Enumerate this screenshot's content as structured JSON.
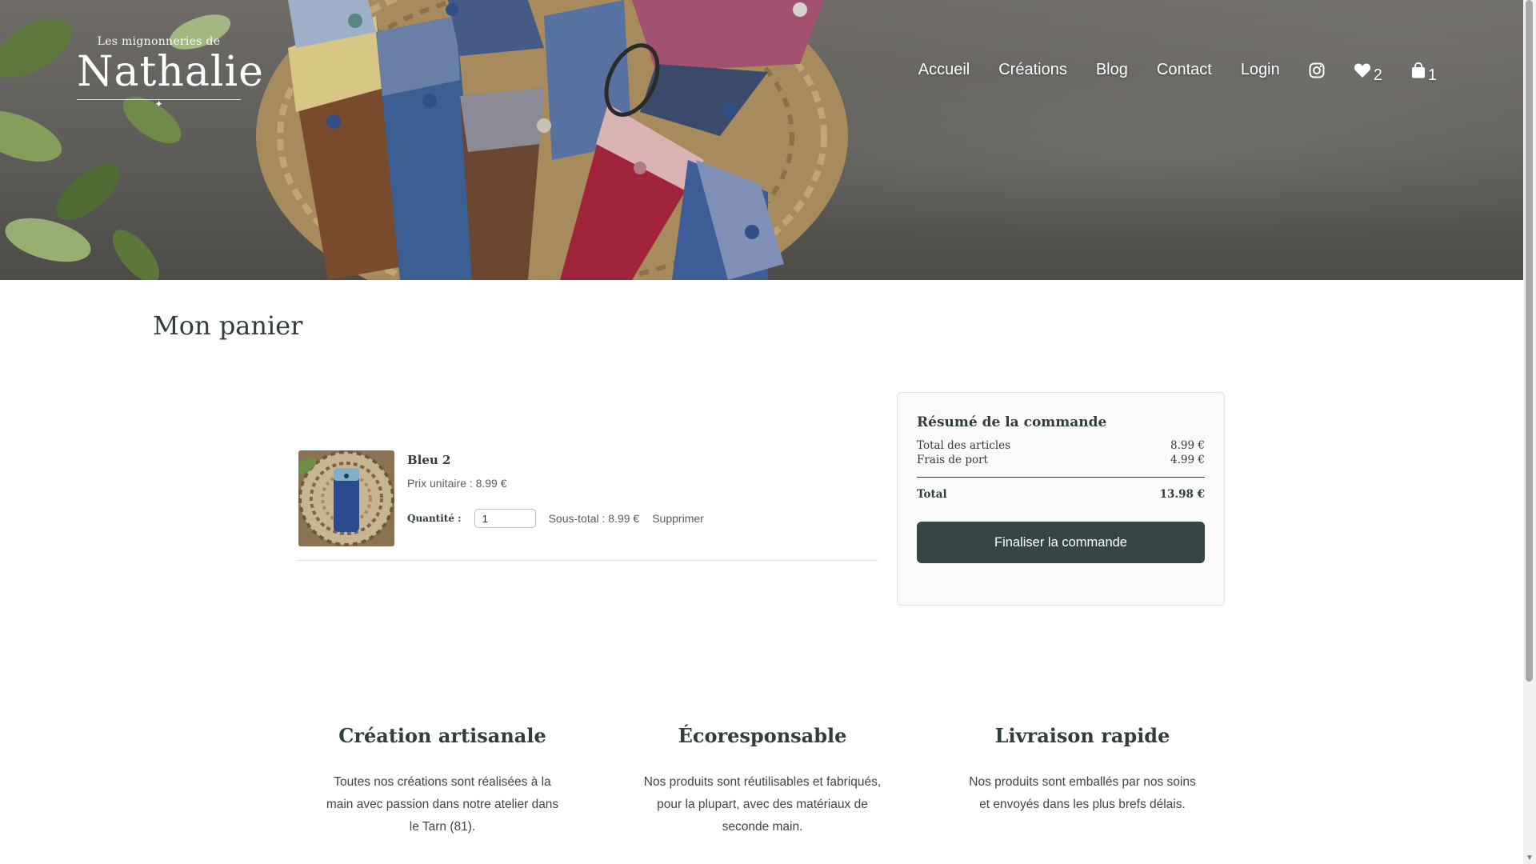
{
  "header": {
    "logo_small": "Les mignonneries de",
    "logo_big": "Nathalie",
    "logo_sparkle": "✦",
    "nav": [
      "Accueil",
      "Créations",
      "Blog",
      "Contact",
      "Login"
    ],
    "wishlist_count": "2",
    "cart_count": "1",
    "icons": [
      "instagram-icon",
      "heart-icon",
      "shopping-bag-icon"
    ]
  },
  "page": {
    "title": "Mon panier"
  },
  "cart": {
    "items": [
      {
        "name": "Bleu 2",
        "unit_price": "Prix unitaire : 8.99 €",
        "quantity_label": "Quantité :",
        "quantity": "1",
        "subtotal": "Sous-total : 8.99 €",
        "remove": "Supprimer"
      }
    ]
  },
  "summary": {
    "title": "Résumé de la commande",
    "items_label": "Total des articles",
    "items_value": "8.99 €",
    "shipping_label": "Frais de port",
    "shipping_value": "4.99 €",
    "total_label": "Total",
    "total_value": "13.98 €",
    "checkout": "Finaliser la commande"
  },
  "features": [
    {
      "title": "Création artisanale",
      "text": "Toutes nos créations sont réalisées à la main avec passion dans notre atelier dans le Tarn (81)."
    },
    {
      "title": "Écoresponsable",
      "text": "Nos produits sont réutilisables et fabriqués, pour la plupart, avec des matériaux de seconde main."
    },
    {
      "title": "Livraison rapide",
      "text": "Nos produits sont emballés par nos soins et envoyés dans les plus brefs délais."
    }
  ],
  "colors": {
    "accent": "#344646",
    "text": "#2f3d3d"
  }
}
